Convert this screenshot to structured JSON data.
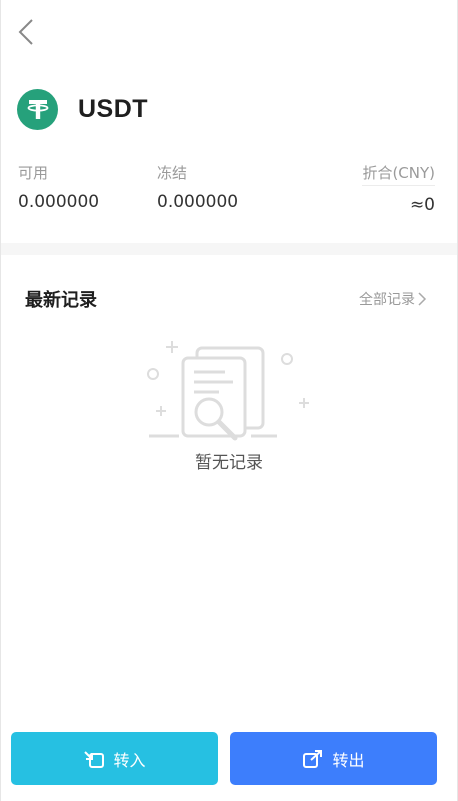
{
  "header": {
    "back_icon": "chevron-left-icon"
  },
  "coin": {
    "name": "USDT",
    "logo_color": "#26a17b",
    "logo_icon": "tether-icon"
  },
  "stats": {
    "available_label": "可用",
    "available_value": "0.000000",
    "frozen_label": "冻结",
    "frozen_value": "0.000000",
    "converted_label": "折合(CNY)",
    "converted_value": "≈0"
  },
  "records": {
    "title": "最新记录",
    "view_all_label": "全部记录",
    "empty_text": "暂无记录"
  },
  "actions": {
    "transfer_in_label": "转入",
    "transfer_in_color": "#26c0e2",
    "transfer_out_label": "转出",
    "transfer_out_color": "#3d7efc"
  }
}
